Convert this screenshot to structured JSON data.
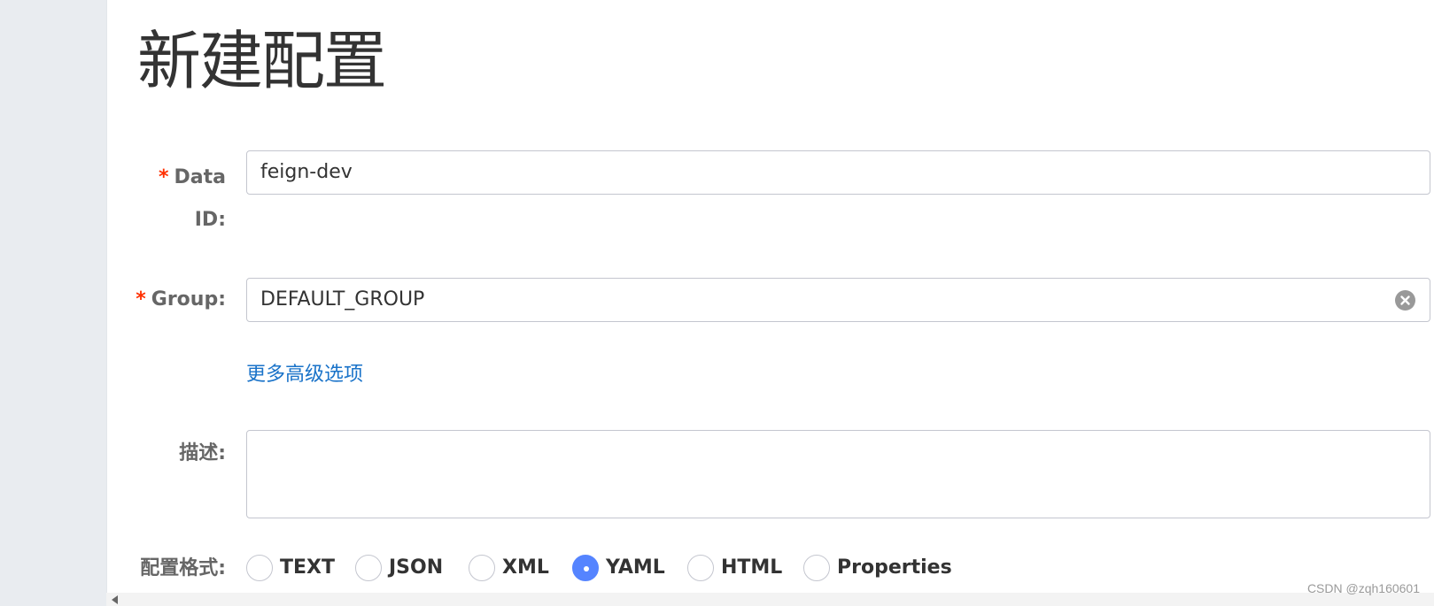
{
  "page": {
    "title": "新建配置"
  },
  "form": {
    "data_id": {
      "required_mark": "*",
      "label_line1": "Data",
      "label_line2": "ID:",
      "value": "feign-dev"
    },
    "group": {
      "required_mark": "*",
      "label": "Group:",
      "value": "DEFAULT_GROUP"
    },
    "advanced_link": "更多高级选项",
    "description": {
      "label": "描述:",
      "value": ""
    },
    "format": {
      "label": "配置格式:",
      "options": [
        "TEXT",
        "JSON",
        "XML",
        "YAML",
        "HTML",
        "Properties"
      ],
      "selected": "YAML"
    }
  },
  "watermark": "CSDN @zqh160601",
  "colors": {
    "accent": "#5584ff",
    "link": "#1a73c9",
    "required": "#ff3000"
  }
}
